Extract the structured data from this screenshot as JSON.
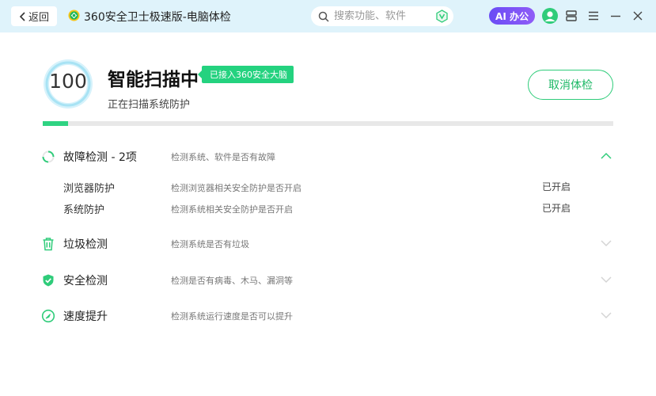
{
  "titlebar": {
    "back_label": "返回",
    "app_title": "360安全卫士极速版-电脑体检",
    "search_placeholder": "搜索功能、软件",
    "ai_label": "AI 办公"
  },
  "header": {
    "score": "100",
    "scan_title": "智能扫描中",
    "brain_badge": "已接入360安全大脑",
    "scan_status": "正在扫描系统防护",
    "cancel_label": "取消体检",
    "progress_fraction": 0.045
  },
  "colors": {
    "accent": "#2fcc7a",
    "titlebar_bg": "#dff3fb",
    "ai_purple": "#7a55f6"
  },
  "sections": [
    {
      "title": "故障检测 - 2项",
      "desc": "检测系统、软件是否有故障",
      "icon": "loading-spinner-icon",
      "expanded": true,
      "items": [
        {
          "title": "浏览器防护",
          "desc": "检测浏览器相关安全防护是否开启",
          "status": "已开启"
        },
        {
          "title": "系统防护",
          "desc": "检测系统相关安全防护是否开启",
          "status": "已开启"
        }
      ]
    },
    {
      "title": "垃圾检测",
      "desc": "检测系统是否有垃圾",
      "icon": "trash-icon",
      "expanded": false
    },
    {
      "title": "安全检测",
      "desc": "检测是否有病毒、木马、漏洞等",
      "icon": "shield-check-icon",
      "expanded": false
    },
    {
      "title": "速度提升",
      "desc": "检测系统运行速度是否可以提升",
      "icon": "speed-gauge-icon",
      "expanded": false
    }
  ]
}
